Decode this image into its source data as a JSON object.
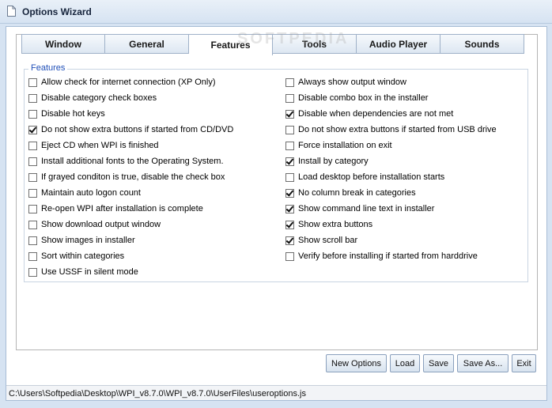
{
  "window": {
    "title": "Options Wizard"
  },
  "watermark": "SOFTPEDIA",
  "tabs": [
    {
      "label": "Window",
      "active": false
    },
    {
      "label": "General",
      "active": false
    },
    {
      "label": "Features",
      "active": true
    },
    {
      "label": "Tools",
      "active": false
    },
    {
      "label": "Audio Player",
      "active": false
    },
    {
      "label": "Sounds",
      "active": false
    }
  ],
  "group": {
    "label": "Features"
  },
  "features_left": [
    {
      "label": "Allow check for internet connection (XP Only)",
      "checked": false
    },
    {
      "label": "Disable category check boxes",
      "checked": false
    },
    {
      "label": "Disable hot keys",
      "checked": false
    },
    {
      "label": "Do not show extra buttons if started from CD/DVD",
      "checked": true
    },
    {
      "label": "Eject CD when WPI is finished",
      "checked": false
    },
    {
      "label": "Install additional fonts to the Operating System.",
      "checked": false
    },
    {
      "label": "If grayed conditon is true, disable the check box",
      "checked": false
    },
    {
      "label": "Maintain auto logon count",
      "checked": false
    },
    {
      "label": "Re-open WPI after installation is complete",
      "checked": false
    },
    {
      "label": "Show download output window",
      "checked": false
    },
    {
      "label": "Show images in installer",
      "checked": false
    },
    {
      "label": "Sort within categories",
      "checked": false
    },
    {
      "label": "Use USSF in silent mode",
      "checked": false
    }
  ],
  "features_right": [
    {
      "label": "Always show output window",
      "checked": false
    },
    {
      "label": "Disable combo box in the installer",
      "checked": false
    },
    {
      "label": "Disable when dependencies are not met",
      "checked": true
    },
    {
      "label": "Do not show extra buttons if started from USB drive",
      "checked": false
    },
    {
      "label": "Force installation on exit",
      "checked": false
    },
    {
      "label": "Install by category",
      "checked": true
    },
    {
      "label": "Load desktop before installation starts",
      "checked": false
    },
    {
      "label": "No column break in categories",
      "checked": true
    },
    {
      "label": "Show command line text in installer",
      "checked": true
    },
    {
      "label": "Show extra buttons",
      "checked": true
    },
    {
      "label": "Show scroll bar",
      "checked": true
    },
    {
      "label": "Verify before installing if started from harddrive",
      "checked": false
    }
  ],
  "buttons": {
    "new_options": "New Options",
    "load": "Load",
    "save": "Save",
    "save_as": "Save As...",
    "exit": "Exit"
  },
  "status": {
    "path": "C:\\Users\\Softpedia\\Desktop\\WPI_v8.7.0\\WPI_v8.7.0\\UserFiles\\useroptions.js"
  }
}
